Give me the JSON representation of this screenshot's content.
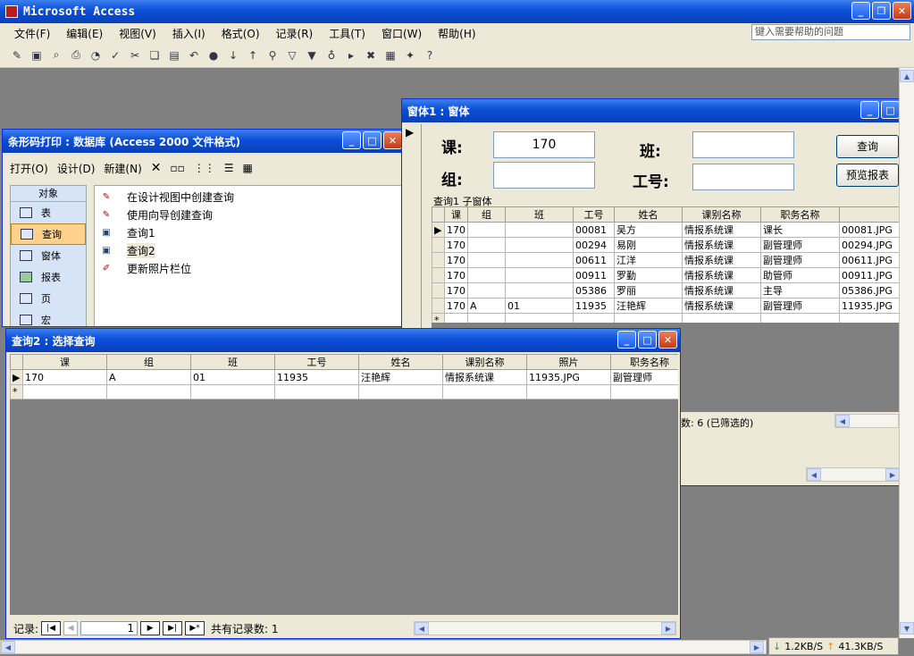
{
  "app": {
    "title": "Microsoft Access",
    "help_placeholder": "键入需要帮助的问题"
  },
  "menu": [
    "文件(F)",
    "编辑(E)",
    "视图(V)",
    "插入(I)",
    "格式(O)",
    "记录(R)",
    "工具(T)",
    "窗口(W)",
    "帮助(H)"
  ],
  "db_window": {
    "title": "条形码打印 : 数据库 (Access 2000 文件格式)",
    "toolbar": {
      "open": "打开(O)",
      "design": "设计(D)",
      "new": "新建(N)"
    },
    "objects_header": "对象",
    "objects": [
      "表",
      "查询",
      "窗体",
      "报表",
      "页",
      "宏"
    ],
    "queries": [
      "在设计视图中创建查询",
      "使用向导创建查询",
      "查询1",
      "查询2",
      "更新照片栏位"
    ]
  },
  "form_window": {
    "title": "窗体1 : 窗体",
    "label_ke": "课:",
    "value_ke": "170",
    "label_ban": "班:",
    "label_zu": "组:",
    "label_gonghao": "工号:",
    "query_button": "查询",
    "preview_button": "预览报表",
    "subform_label": "查询1 子窗体",
    "columns": [
      "课",
      "组",
      "班",
      "工号",
      "姓名",
      "课别名称",
      "职务名称",
      ""
    ],
    "rows": [
      [
        "170",
        "",
        "",
        "00081",
        "吴方",
        "情报系统课",
        "课长",
        "00081.JPG"
      ],
      [
        "170",
        "",
        "",
        "00294",
        "易刚",
        "情报系统课",
        "副管理师",
        "00294.JPG"
      ],
      [
        "170",
        "",
        "",
        "00611",
        "江洋",
        "情报系统课",
        "副管理师",
        "00611.JPG"
      ],
      [
        "170",
        "",
        "",
        "00911",
        "罗勤",
        "情报系统课",
        "助管师",
        "00911.JPG"
      ],
      [
        "170",
        "",
        "",
        "05386",
        "罗丽",
        "情报系统课",
        "主导",
        "05386.JPG"
      ],
      [
        "170",
        "A",
        "01",
        "11935",
        "汪艳辉",
        "情报系统课",
        "副管理师",
        "11935.JPG"
      ]
    ],
    "record_count": "数: 6 (已筛选的)"
  },
  "query_window": {
    "title": "查询2 : 选择查询",
    "columns": [
      "课",
      "组",
      "班",
      "工号",
      "姓名",
      "课别名称",
      "照片",
      "职务名称"
    ],
    "rows": [
      [
        "170",
        "A",
        "01",
        "11935",
        "汪艳辉",
        "情报系统课",
        "11935.JPG",
        "副管理师"
      ]
    ],
    "nav_label": "记录:",
    "nav_value": "1",
    "total": "共有记录数: 1"
  },
  "status": {
    "down": "1.2KB/S",
    "up": "41.3KB/S"
  }
}
